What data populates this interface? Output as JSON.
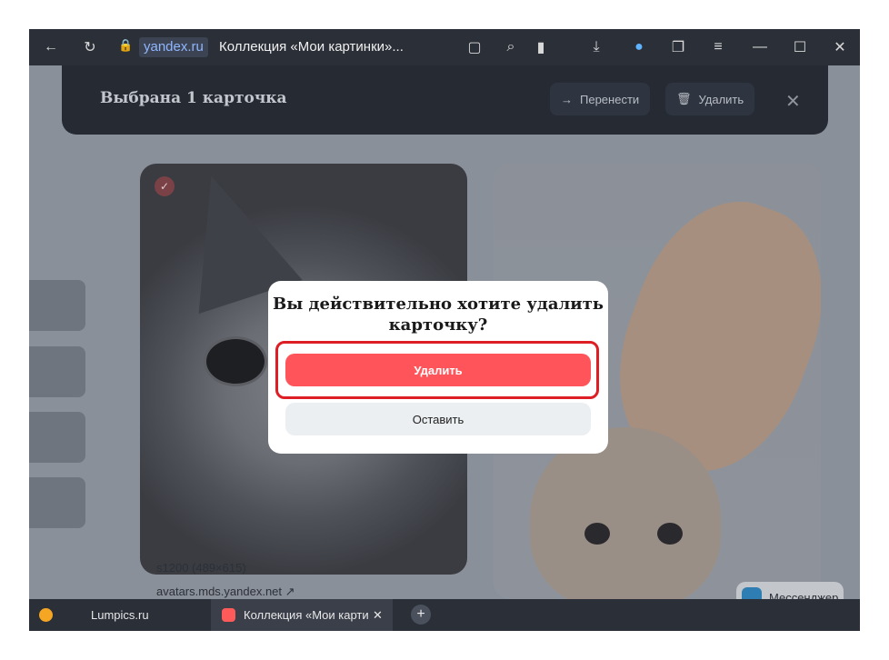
{
  "browser": {
    "domain": "yandex.ru",
    "page_title": "Коллекция «Мои картинки»...",
    "nav": {
      "back": "←",
      "reload": "↻",
      "lock": "🔒"
    },
    "toolbar_icons": [
      "▢",
      "⌕",
      "▮",
      "⤓",
      "●",
      "❐",
      "≡",
      "—",
      "☐",
      "✕"
    ]
  },
  "selection_bar": {
    "title": "Выбрана 1 карточка",
    "move_label": "Перенести",
    "delete_label": "Удалить",
    "close": "✕"
  },
  "cards": [
    {
      "size": "s1200 (489×615)",
      "source": "avatars.mds.yandex.net ↗",
      "checked": "✓"
    }
  ],
  "messenger": {
    "label": "Мессенджер"
  },
  "dialog": {
    "question": "Вы действительно хотите удалить карточку?",
    "confirm_label": "Удалить",
    "cancel_label": "Оставить",
    "highlight_color": "#dd1f25"
  },
  "tabs": [
    {
      "label": "Lumpics.ru",
      "close": ""
    },
    {
      "label": "Коллекция «Мои карти",
      "close": "✕"
    }
  ],
  "new_tab": "+"
}
